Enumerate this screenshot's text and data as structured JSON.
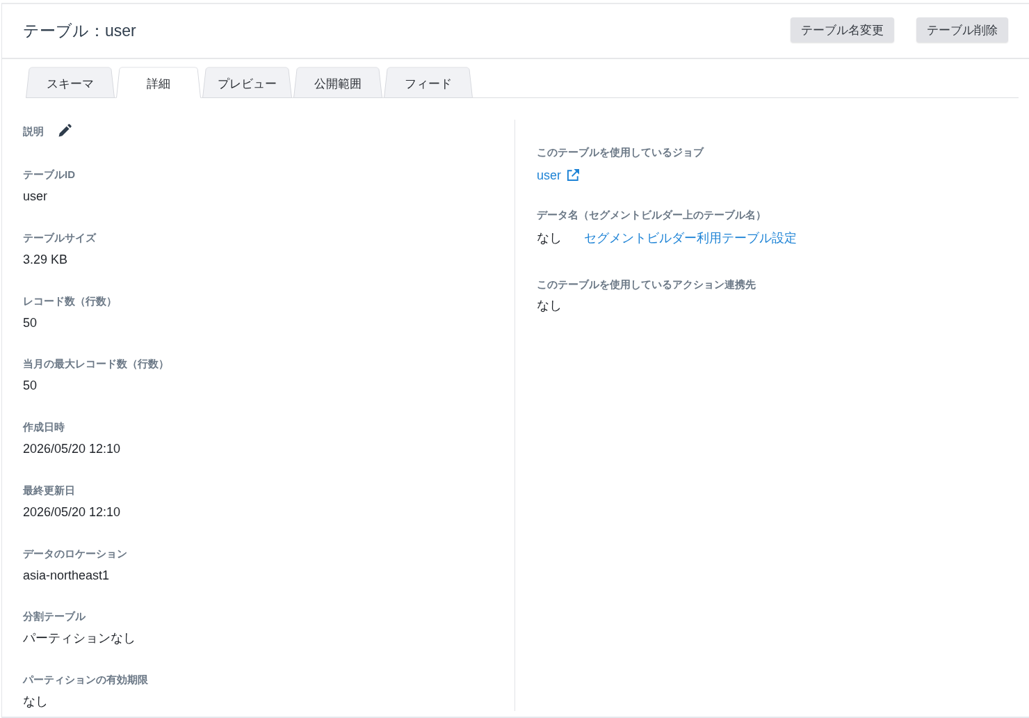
{
  "header": {
    "title": "テーブル：user",
    "buttons": [
      {
        "label": "テーブル名変更"
      },
      {
        "label": "テーブル削除"
      }
    ]
  },
  "tabs": [
    {
      "label": "スキーマ",
      "selected": false
    },
    {
      "label": "詳細",
      "selected": true
    },
    {
      "label": "プレビュー",
      "selected": false
    },
    {
      "label": "公開範囲",
      "selected": false
    },
    {
      "label": "フィード",
      "selected": false
    }
  ],
  "details_left": [
    {
      "kind": "editable",
      "label": "説明"
    },
    {
      "kind": "text",
      "label": "テーブルID",
      "value": "user"
    },
    {
      "kind": "text",
      "label": "テーブルサイズ",
      "value": "3.29 KB"
    },
    {
      "kind": "text",
      "label": "レコード数（行数）",
      "value": "50"
    },
    {
      "kind": "text",
      "label": "当月の最大レコード数（行数）",
      "value": "50"
    },
    {
      "kind": "text",
      "label": "作成日時",
      "value": "2026/05/20 12:10"
    },
    {
      "kind": "text",
      "label": "最終更新日",
      "value": "2026/05/20 12:10"
    },
    {
      "kind": "text",
      "label": "データのロケーション",
      "value": "asia-northeast1"
    },
    {
      "kind": "text",
      "label": "分割テーブル",
      "value": "パーティションなし"
    },
    {
      "kind": "text",
      "label": "パーティションの有効期限",
      "value": "なし"
    }
  ],
  "details_right": [
    {
      "kind": "external_link",
      "label": "このテーブルを使用しているジョブ",
      "value": "user"
    },
    {
      "kind": "text_with_link",
      "label": "データ名（セグメントビルダー上のテーブル名）",
      "value": "なし",
      "link": "セグメントビルダー利用テーブル設定"
    },
    {
      "kind": "text",
      "label": "このテーブルを使用しているアクション連携先",
      "value": "なし"
    }
  ]
}
